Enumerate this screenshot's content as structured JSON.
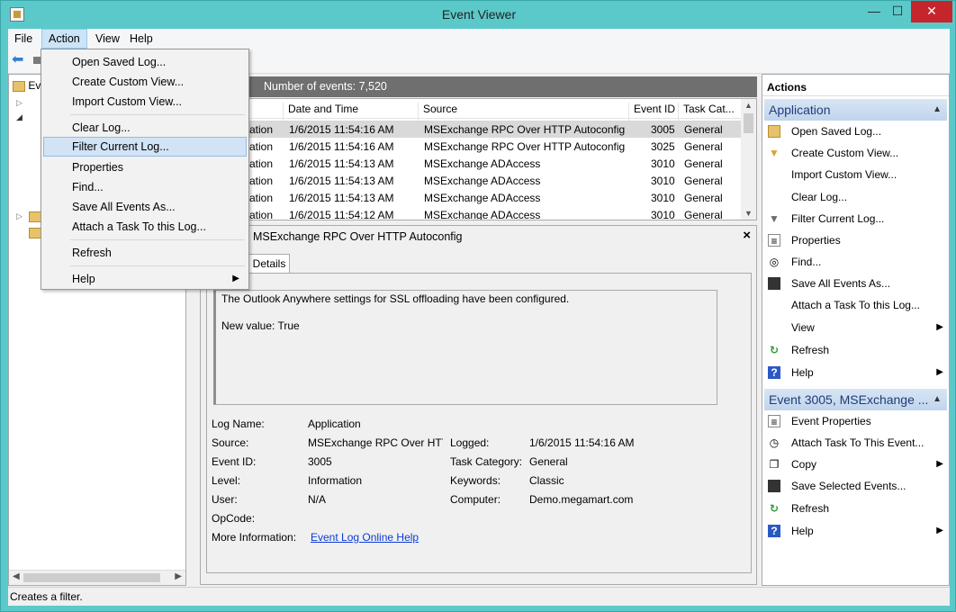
{
  "window": {
    "title": "Event Viewer",
    "minimize": "—",
    "maximize": "☐",
    "close": "✕"
  },
  "menubar": {
    "file": "File",
    "action": "Action",
    "view": "View",
    "help": "Help"
  },
  "tree": {
    "root_label": "Ev"
  },
  "log_header": {
    "count_text": "Number of events: 7,520"
  },
  "grid": {
    "columns": [
      "Date and Time",
      "Source",
      "Event ID",
      "Task Cat..."
    ],
    "rows": [
      {
        "level": "ation",
        "date": "1/6/2015 11:54:16 AM",
        "source": "MSExchange RPC Over HTTP Autoconfig",
        "event_id": "3005",
        "task": "General"
      },
      {
        "level": "ation",
        "date": "1/6/2015 11:54:16 AM",
        "source": "MSExchange RPC Over HTTP Autoconfig",
        "event_id": "3025",
        "task": "General"
      },
      {
        "level": "ation",
        "date": "1/6/2015 11:54:13 AM",
        "source": "MSExchange ADAccess",
        "event_id": "3010",
        "task": "General"
      },
      {
        "level": "ation",
        "date": "1/6/2015 11:54:13 AM",
        "source": "MSExchange ADAccess",
        "event_id": "3010",
        "task": "General"
      },
      {
        "level": "ation",
        "date": "1/6/2015 11:54:13 AM",
        "source": "MSExchange ADAccess",
        "event_id": "3010",
        "task": "General"
      },
      {
        "level": "ation",
        "date": "1/6/2015 11:54:12 AM",
        "source": "MSExchange ADAccess",
        "event_id": "3010",
        "task": "General"
      }
    ]
  },
  "detail": {
    "title": "MSExchange RPC Over HTTP Autoconfig",
    "close": "×",
    "tab": "Details",
    "description_line1": "The Outlook Anywhere settings for SSL offloading have been configured.",
    "description_line2": "New value: True",
    "props": {
      "log_name_label": "Log Name:",
      "log_name": "Application",
      "source_label": "Source:",
      "source": "MSExchange RPC Over HTTF",
      "logged_label": "Logged:",
      "logged": "1/6/2015 11:54:16 AM",
      "event_id_label": "Event ID:",
      "event_id": "3005",
      "task_cat_label": "Task Category:",
      "task_cat": "General",
      "level_label": "Level:",
      "level": "Information",
      "keywords_label": "Keywords:",
      "keywords": "Classic",
      "user_label": "User:",
      "user": "N/A",
      "computer_label": "Computer:",
      "computer": "Demo.megamart.com",
      "opcode_label": "OpCode:",
      "more_info_label": "More Information:",
      "more_info_link": "Event Log Online Help"
    }
  },
  "actions": {
    "header": "Actions",
    "section1": "Application",
    "section1_items": [
      {
        "label": "Open Saved Log...",
        "icon": "folder-icon"
      },
      {
        "label": "Create Custom View...",
        "icon": "funnel-icon"
      },
      {
        "label": "Import Custom View...",
        "icon": ""
      },
      {
        "label": "Clear Log...",
        "icon": ""
      },
      {
        "label": "Filter Current Log...",
        "icon": "funnel-icon"
      },
      {
        "label": "Properties",
        "icon": "properties-icon"
      },
      {
        "label": "Find...",
        "icon": "binoculars-icon"
      },
      {
        "label": "Save All Events As...",
        "icon": "disk-icon"
      },
      {
        "label": "Attach a Task To this Log...",
        "icon": ""
      },
      {
        "label": "View",
        "icon": ""
      },
      {
        "label": "Refresh",
        "icon": "refresh-icon"
      },
      {
        "label": "Help",
        "icon": "help-icon"
      }
    ],
    "section2": "Event 3005, MSExchange ...",
    "section2_items": [
      {
        "label": "Event Properties",
        "icon": "properties-icon"
      },
      {
        "label": "Attach Task To This Event...",
        "icon": "task-icon"
      },
      {
        "label": "Copy",
        "icon": "copy-icon"
      },
      {
        "label": "Save Selected Events...",
        "icon": "disk-icon"
      },
      {
        "label": "Refresh",
        "icon": "refresh-icon"
      },
      {
        "label": "Help",
        "icon": "help-icon"
      }
    ]
  },
  "dropdown": {
    "items": [
      "Open Saved Log...",
      "Create Custom View...",
      "Import Custom View...",
      "Clear Log...",
      "Filter Current Log...",
      "Properties",
      "Find...",
      "Save All Events As...",
      "Attach a Task To this Log...",
      "Refresh",
      "Help"
    ]
  },
  "status": {
    "text": "Creates a filter."
  },
  "colors": {
    "chrome": "#5bc9c9",
    "close_button": "#c7252c",
    "section_header": "#bfd4ec",
    "link": "#0b3bd8"
  }
}
